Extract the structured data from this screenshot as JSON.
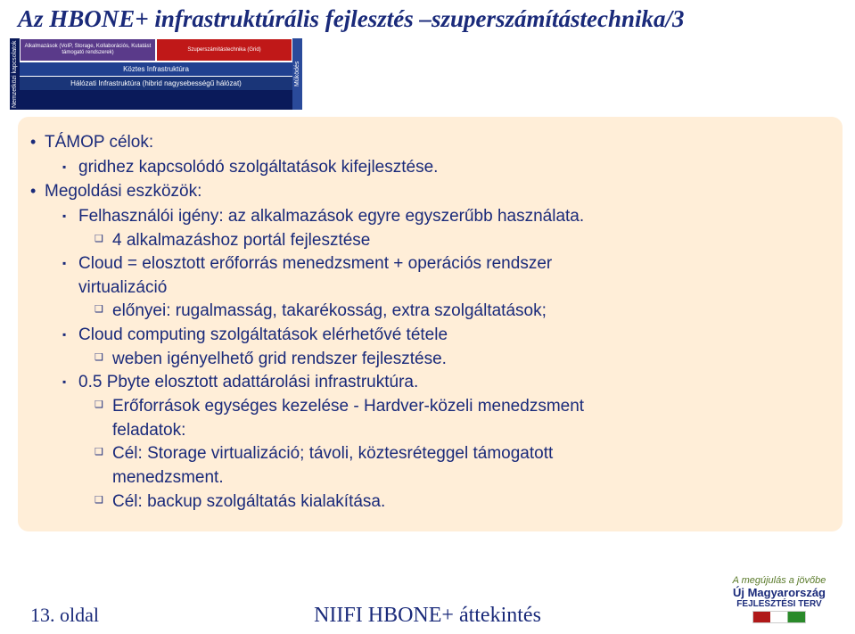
{
  "title": "Az HBONE+ infrastruktúrális fejlesztés –szuperszámítástechnika/3",
  "agenda": {
    "left_vert": "Nemzetközi kapcsolatok",
    "right_vert": "Működés",
    "cells": {
      "purple": "Alkalmazások (VoIP, Storage, Kollaborációs, Kutatást támogató rendszerek)",
      "red": "Szuperszámítástechnika (Grid)"
    },
    "row1": "Köztes Infrastruktúra",
    "row2": "Hálózati Infrastruktúra (hibrid nagysebességű hálózat)"
  },
  "content": {
    "b1": "TÁMOP célok:",
    "b1a": "gridhez kapcsolódó szolgáltatások kifejlesztése.",
    "b2": "Megoldási eszközök:",
    "b2a": "Felhasználói igény: az alkalmazások egyre egyszerűbb használata.",
    "b2a1": "4 alkalmazáshoz portál fejlesztése",
    "b2b_l1": "Cloud = elosztott erőforrás menedzsment + operációs rendszer",
    "b2b_l2": "virtualizáció",
    "b2b1": "előnyei: rugalmasság, takarékosság, extra szolgáltatások;",
    "b2c": "Cloud computing szolgáltatások elérhetővé tétele",
    "b2c1": "weben igényelhető grid rendszer fejlesztése.",
    "b2d": "0.5 Pbyte elosztott adattárolási infrastruktúra.",
    "b2d1_l1": "Erőforrások egységes kezelése - Hardver-közeli menedzsment",
    "b2d1_l2": "feladatok:",
    "b2d1a_l1": "Cél: Storage virtualizáció; távoli, köztesréteggel támogatott",
    "b2d1a_l2": "menedzsment.",
    "b2d1b": "Cél: backup szolgáltatás kialakítása."
  },
  "footer": {
    "page": "13. oldal",
    "center": "NIIFI HBONE+ áttekintés",
    "logo": {
      "tag": "A megújulás a jövőbe",
      "line1": "Új Magyarország",
      "line2": "FEJLESZTÉSI TERV"
    }
  }
}
